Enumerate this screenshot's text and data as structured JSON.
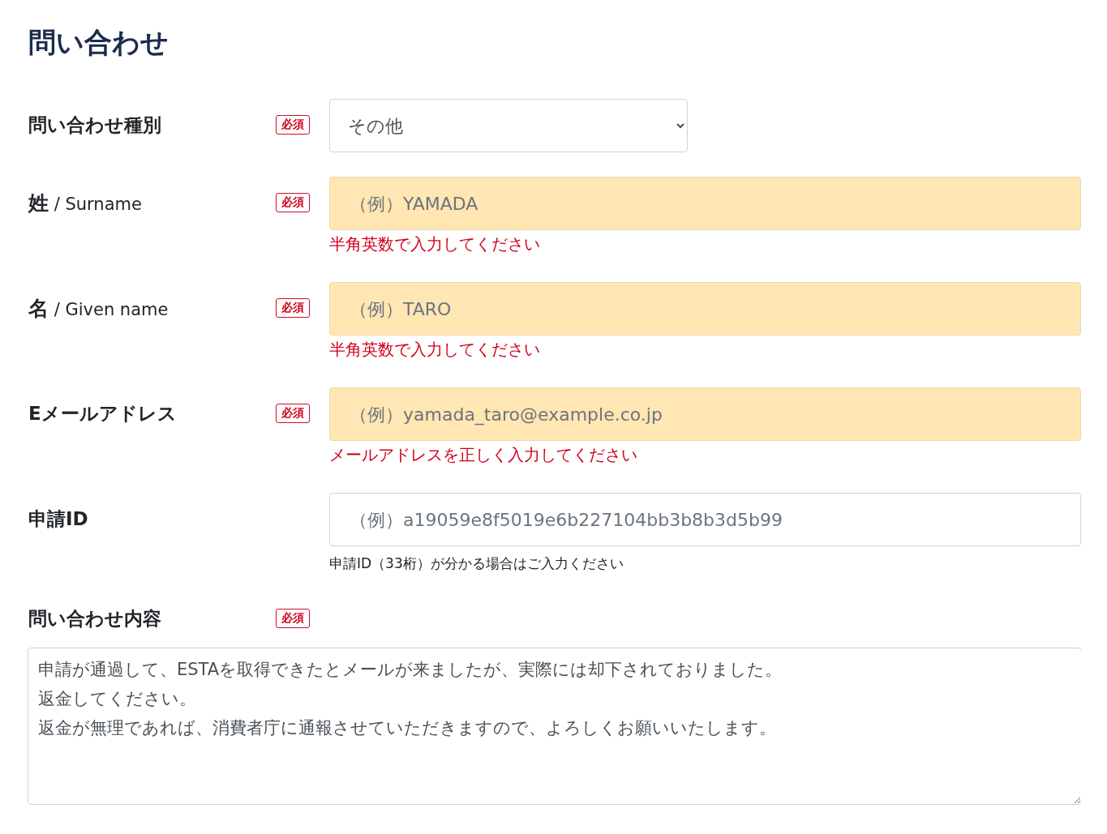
{
  "title": "問い合わせ",
  "fields": [
    {
      "kind": "select",
      "label": "問い合わせ種別",
      "required_badge": "必須",
      "value": "その他"
    },
    {
      "kind": "text",
      "label": "**姓** / Surname",
      "required_badge": "必須",
      "placeholder": "（例）YAMADA",
      "highlighted": true,
      "message": {
        "kind": "error",
        "text": "半角英数で入力してください"
      }
    },
    {
      "kind": "text",
      "label": "**名** / Given name",
      "required_badge": "必須",
      "placeholder": "（例）TARO",
      "highlighted": true,
      "message": {
        "kind": "error",
        "text": "半角英数で入力してください"
      }
    },
    {
      "kind": "text",
      "label": "Eメールアドレス",
      "required_badge": "必須",
      "placeholder": "（例）yamada_taro@example.co.jp",
      "highlighted": true,
      "message": {
        "kind": "error",
        "text": "メールアドレスを正しく入力してください"
      }
    },
    {
      "kind": "text",
      "label": "申請ID",
      "placeholder": "（例）a19059e8f5019e6b227104bb3b8b3d5b99",
      "highlighted": false,
      "message": {
        "kind": "hint",
        "text": "申請ID（33桁）が分かる場合はご入力ください"
      }
    },
    {
      "kind": "textarea",
      "label": "問い合わせ内容",
      "required_badge": "必須",
      "lines": [
        "申請が通過して、ESTAを取得できたとメールが来ましたが、実際には却下されておりました。",
        "返金してください。",
        "返金が無理であれば、消費者庁に通報させていただきますので、よろしくお願いいたします。"
      ]
    }
  ]
}
